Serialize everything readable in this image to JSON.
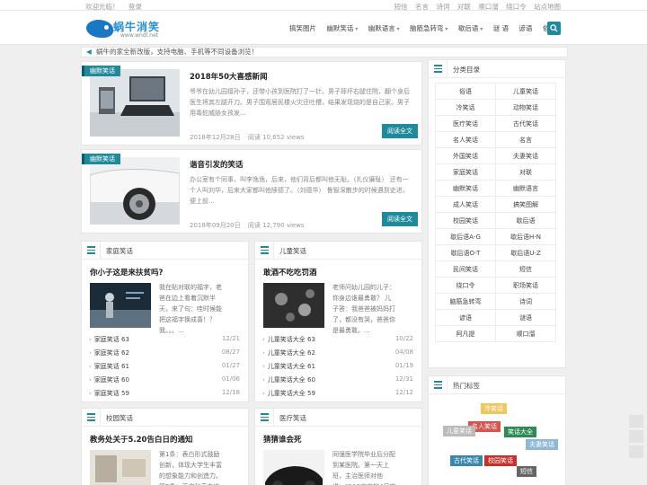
{
  "topbar": {
    "left": [
      "欢迎光临！",
      "登录"
    ],
    "right": [
      "短信",
      "名言",
      "诗词",
      "对联",
      "顺口溜",
      "绕口令",
      "站点地图"
    ]
  },
  "logo": {
    "brand": "蜗牛消笑",
    "url": "www.wndl.net"
  },
  "nav": [
    {
      "label": "搞笑图片",
      "drop": false
    },
    {
      "label": "幽默笑话",
      "drop": true
    },
    {
      "label": "幽默语言",
      "drop": true
    },
    {
      "label": "脑筋急转弯",
      "drop": true
    },
    {
      "label": "歇后语",
      "drop": true
    },
    {
      "label": "谜 语",
      "drop": false
    },
    {
      "label": "谚语",
      "drop": false
    },
    {
      "label": "俗语",
      "drop": false
    }
  ],
  "search": {
    "icon": "search-icon"
  },
  "notice": {
    "icon": "megaphone-icon",
    "text": "蜗牛的家全新改版，支持电脑、手机等不同设备浏览！"
  },
  "articles": [
    {
      "category": "幽默笑话",
      "title": "2018年50大喜感新闻",
      "excerpt": "爷爷在幼儿园接孙子，还带小孩到医院打了一针。男子摔坏右腿住院，翻个身后医生将其左腿开刀。男子围观居民楼火灾还吐槽，结果发现烧的是自己家。男子用毒蛇威胁女孩发...",
      "date": "2018年12月28日",
      "views": "阅读 10,652 views",
      "more": "阅读全文"
    },
    {
      "category": "幽默笑话",
      "title": "谐音引发的笑话",
      "excerpt": "办公室有个同事，叫李逸逸，后来，他们背后都叫他无耻。（扎仪廉耻） 还有一个人叫刘华，后来大家都叫他牍德了。（刘德华） 鲁智深散步的时候遇到史进，便上前...",
      "date": "2018年09月20日",
      "views": "阅读 12,790 views",
      "more": "阅读全文"
    }
  ],
  "boxes": [
    {
      "header": "家庭笑话",
      "title": "你小子这是来扶贫吗?",
      "excerpt": "我在贴对联的福字，老爸在边上看着沉默半天，来了句：哇时候能把这福字换成喜！？ 我。。。...",
      "items": [
        {
          "t": "家庭笑话 63",
          "d": "12/21"
        },
        {
          "t": "家庭笑话 62",
          "d": "08/27"
        },
        {
          "t": "家庭笑话 61",
          "d": "01/27"
        },
        {
          "t": "家庭笑话 60",
          "d": "01/06"
        },
        {
          "t": "家庭笑话 59",
          "d": "12/18"
        }
      ]
    },
    {
      "header": "儿童笑话",
      "title": "敢酒不吃吃罚酒",
      "excerpt": "老师问幼儿园的儿子：你身边谁最勇敢？ 儿子答：我爸爸被妈妈打了，都没有哭，爸爸你是最勇敢。...",
      "items": [
        {
          "t": "儿童笑话大全 63",
          "d": "10/22"
        },
        {
          "t": "儿童笑话大全 62",
          "d": "04/08"
        },
        {
          "t": "儿童笑话大全 61",
          "d": "01/19"
        },
        {
          "t": "儿童笑话大全 60",
          "d": "12/31"
        },
        {
          "t": "儿童笑话大全 59",
          "d": "12/12"
        }
      ]
    },
    {
      "header": "校园笑话",
      "title": "教务处关于5.20告白日的通知",
      "excerpt": "第1条：表白形式鼓励创新，体现大学生丰富的想象能力和创造力。 第2条：不主张表白追求物质..."
    },
    {
      "header": "医疗笑话",
      "title": "猜猜谁会死",
      "excerpt": "同强医学院毕业后分配到某医院。第一天上班，主治医师对他说：“116病房的4号床患者..."
    }
  ],
  "sidebar": {
    "catalog": {
      "header": "分类目录",
      "items": [
        "俗语",
        "儿童笑话",
        "冷笑话",
        "动物笑话",
        "医疗笑话",
        "古代笑话",
        "名人笑话",
        "名言",
        "外国笑话",
        "夫妻笑话",
        "家庭笑话",
        "对联",
        "幽默笑话",
        "幽默语言",
        "成人笑话",
        "搞笑图解",
        "校园笑话",
        "歇后语",
        "歇后语A-G",
        "歇后语H-N",
        "歇后语O-T",
        "歇后语U-Z",
        "民间笑话",
        "短信",
        "绕口令",
        "职场笑话",
        "脑筋急转弯",
        "诗词",
        "谚语",
        "谜语",
        "阿凡提",
        "顺口溜"
      ]
    },
    "tags": {
      "header": "热门标签",
      "items": [
        {
          "t": "冷笑话",
          "c": "#f0c75e"
        },
        {
          "t": "名人笑话",
          "c": "#d9534f"
        },
        {
          "t": "儿童笑话",
          "c": "#bbbbbb"
        },
        {
          "t": "笑话大全",
          "c": "#2e8b57"
        },
        {
          "t": "夫妻笑话",
          "c": "#8fb8d8"
        },
        {
          "t": "古代笑话",
          "c": "#3a87ad"
        },
        {
          "t": "校园笑话",
          "c": "#c9302c"
        },
        {
          "t": "短信",
          "c": "#666666"
        }
      ]
    }
  }
}
